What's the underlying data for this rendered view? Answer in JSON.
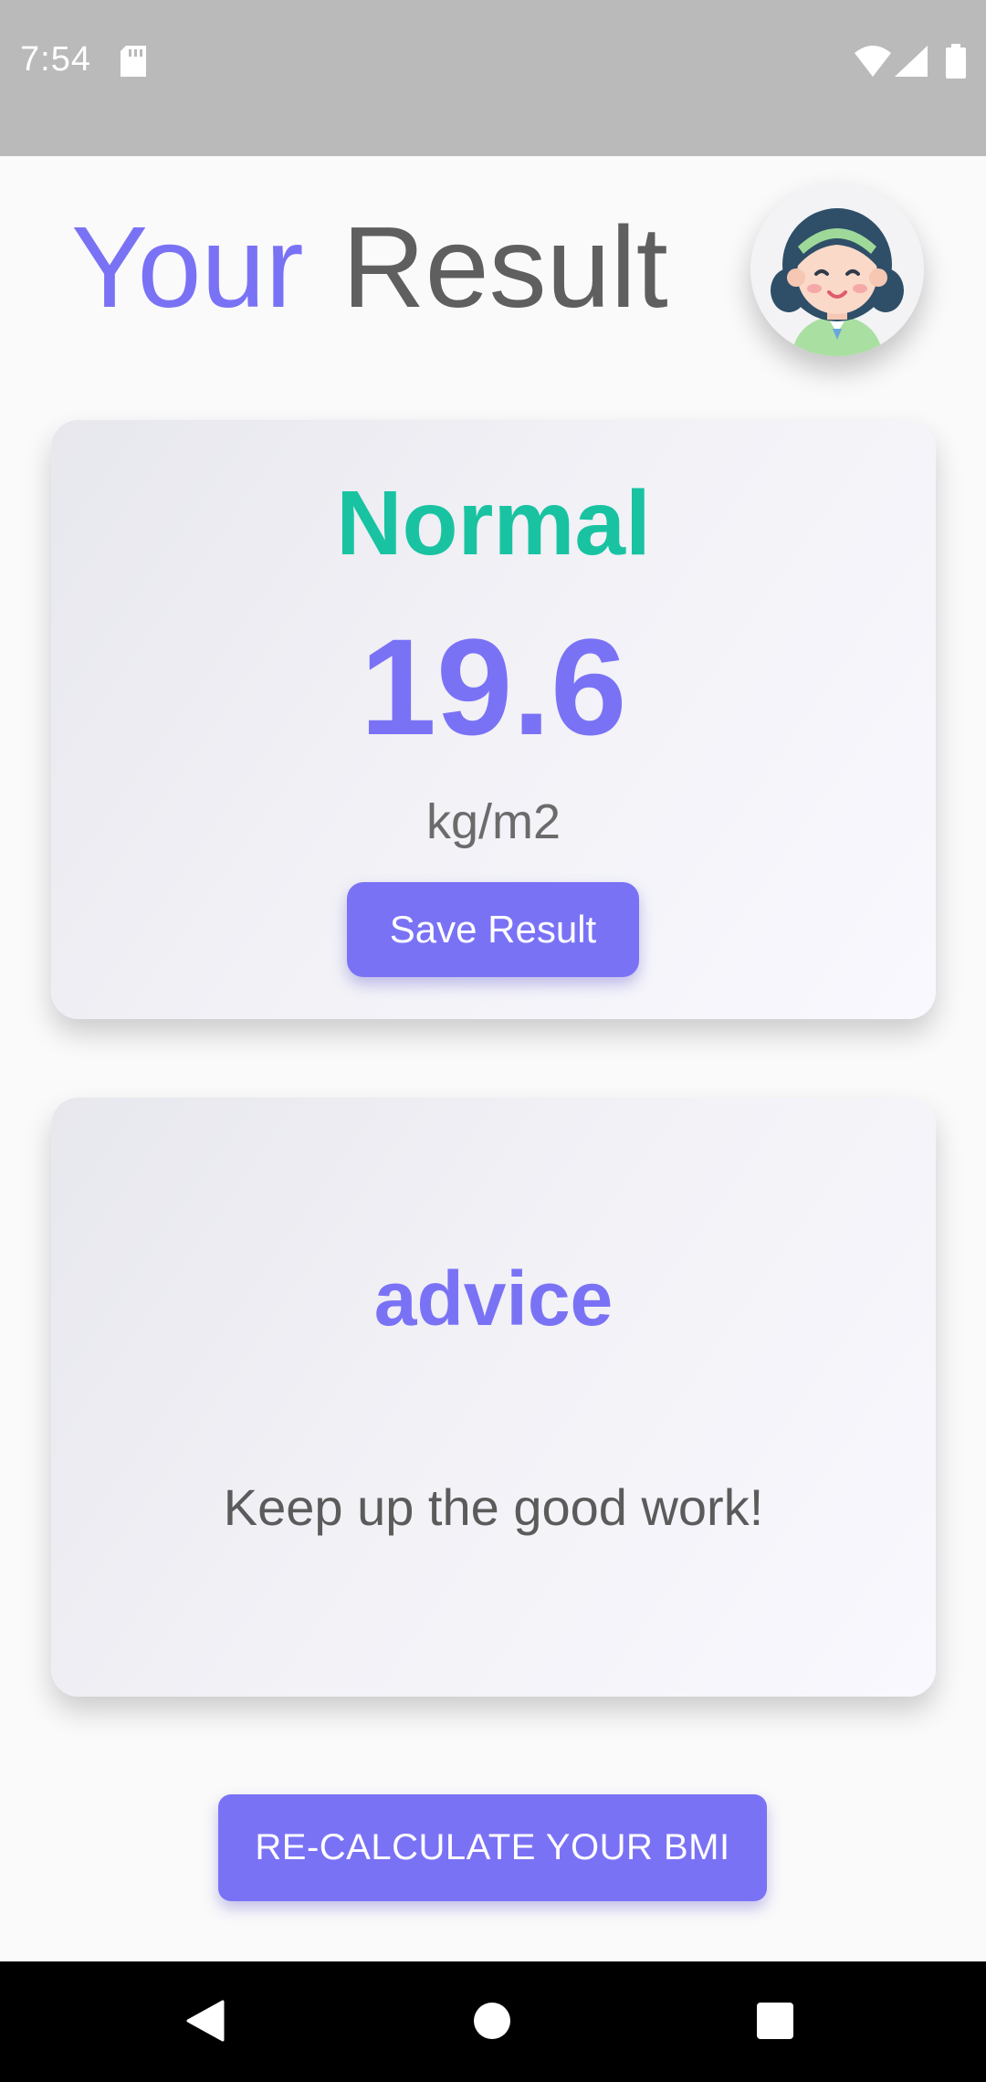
{
  "status_bar": {
    "time": "7:54",
    "icons": [
      "sd-card-icon",
      "wifi-icon",
      "cell-signal-icon",
      "battery-icon"
    ]
  },
  "header": {
    "title_part1": "Your",
    "title_part2": "Result",
    "avatar": "avatar-girl-icon"
  },
  "result_card": {
    "status": "Normal",
    "bmi": "19.6",
    "unit": "kg/m2",
    "save_label": "Save Result"
  },
  "advice_card": {
    "title": "advice",
    "text": "Keep up the good work!"
  },
  "footer": {
    "recalculate_label": "RE-CALCULATE YOUR BMI"
  },
  "nav_bar": {
    "buttons": [
      "back-icon",
      "home-icon",
      "recents-icon"
    ]
  },
  "colors": {
    "accent": "#7a72f5",
    "status_normal": "#19c3a2",
    "title_gray": "#5f5f5f"
  }
}
